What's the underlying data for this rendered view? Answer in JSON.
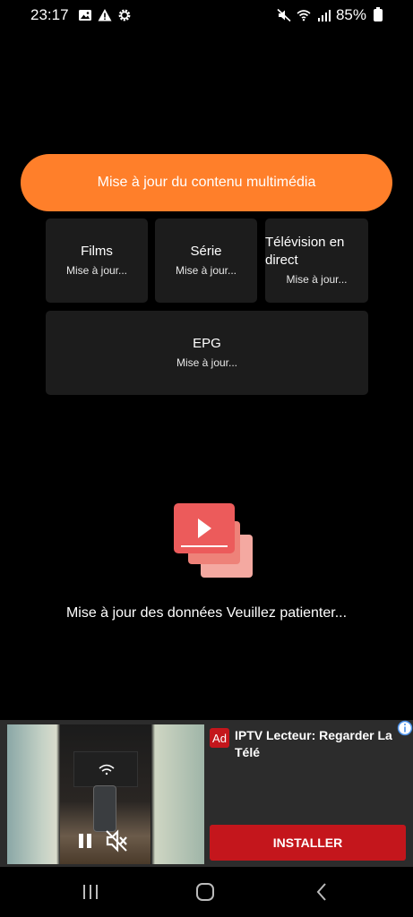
{
  "status_bar": {
    "time": "23:17",
    "battery": "85%",
    "icons": [
      "gallery-icon",
      "warning-icon",
      "settings-icon",
      "mute-icon",
      "wifi-icon",
      "signal-icon",
      "battery-icon"
    ]
  },
  "main": {
    "update_button_label": "Mise à jour du contenu multimédia",
    "tiles": [
      {
        "title": "Films",
        "status": "Mise à jour..."
      },
      {
        "title": "Série",
        "status": "Mise à jour..."
      },
      {
        "title": "Télévision en direct",
        "status": "Mise à jour..."
      },
      {
        "title": "EPG",
        "status": "Mise à jour..."
      }
    ],
    "loading_text": "Mise à jour des données Veuillez patienter..."
  },
  "ad": {
    "badge": "Ad",
    "title": "IPTV Lecteur: Regarder La Télé",
    "install_label": "INSTALLER"
  },
  "colors": {
    "accent": "#ff7f2a",
    "tile_background": "#1c1c1c",
    "ad_button": "#c4161c",
    "illustration": "#ec5b5b"
  }
}
